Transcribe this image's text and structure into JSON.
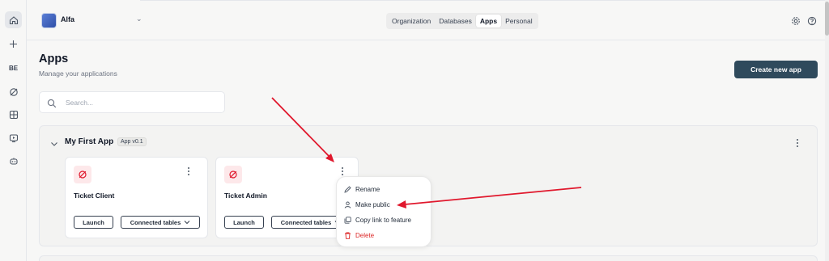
{
  "workspace": {
    "name": "Alfa"
  },
  "rail": {
    "be_label": "BE"
  },
  "nav_tabs": [
    {
      "label": "Organization",
      "active": false
    },
    {
      "label": "Databases",
      "active": false
    },
    {
      "label": "Apps",
      "active": true
    },
    {
      "label": "Personal",
      "active": false
    }
  ],
  "page": {
    "title": "Apps",
    "subtitle": "Manage your applications",
    "create_label": "Create new app"
  },
  "search": {
    "placeholder": "Search..."
  },
  "group": {
    "title": "My First App",
    "version_badge": "App v0.1"
  },
  "cards": [
    {
      "title": "Ticket Client",
      "launch_label": "Launch",
      "connected_label": "Connected tables"
    },
    {
      "title": "Ticket Admin",
      "launch_label": "Launch",
      "connected_label": "Connected tables"
    }
  ],
  "context_menu": {
    "items": [
      {
        "label": "Rename",
        "icon": "pencil-icon"
      },
      {
        "label": "Make public",
        "icon": "user-icon"
      },
      {
        "label": "Copy link to feature",
        "icon": "copy-icon"
      },
      {
        "label": "Delete",
        "icon": "trash-icon"
      }
    ]
  },
  "colors": {
    "accent": "#2f4a5c",
    "danger": "#dc2626",
    "annotation_arrow": "#e0182d",
    "app_icon_bg": "#fde8ea"
  }
}
